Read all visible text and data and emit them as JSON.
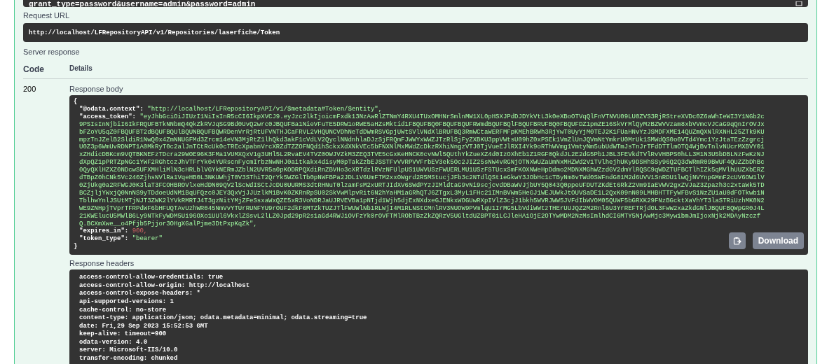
{
  "curl_tail": {
    "text": "grant_type=password&username=admin&password=admin"
  },
  "request_url": {
    "label": "Request URL",
    "value": "http://localhost/LFRepositoryAPI/v1/Repositories/laserfiche/Token"
  },
  "server_response": {
    "label": "Server response",
    "columns": [
      "Code",
      "Details"
    ],
    "code": "200",
    "body_label": "Response body",
    "body": {
      "open": "{",
      "close": "}",
      "entries": [
        {
          "key": "\"@odata.context\":",
          "value": "\"http://localhost/LFRepositoryAPI/v1/$metadata#Token/$entity\",",
          "kind": "string"
        },
        {
          "key": "\"access_token\":",
          "value": "\"eyJhbGciOiJIUzI1NiIsInR5cCI6IkpXVCJ9.eyJzc2lkIjoicmFxdk13NzAwRlZTNmY4RXU4TUxOMHNrSmlnMW1XL0pHSXJPdDJDYkVtL3k0eXBoOTVqQlFnVTNVU09LU0ZVS3RjRStreXVDc0Z6aWhIeWI3Y1NGb2c9PSIsInNjbiI6IkFRQUFBTkNNbmQ4QkZkRVJqSG9Bd0UvQ2wrc0JBQUFBa1NieVFuTE5DRW1oRWE5aHZsMktid1FBQUFBQ0FBQUFBQUFRWmdBQUFBQlFBQUFBRUFBQ0FBQUFDZ1pmZE16SkVrMlQyMzBZWVVzam8xbVVmcVJCaG9qQnIrOVJxbFZoYU5qZ0FBQUFBT2dBQUFBQUlBQUNBQUFBQWRDenVrRjRtUFVNTHJCaFRVL2VHQUNCVDhNeTdDWmRSVGpjUWtSVlVNdXlBRUFBQ3RmWCtaWERFMFpKMEhBRWh3RjYwT0UyYjM0TEJ2K1FUaHNvYzJSMDFXME14QUZmQXNlRXNHL25ZTk9KUmpzTnJZelB2SldiR1NwQ0x4ZmNNUGFMd3Zrcm14eVN3MjRtZ1lhQkd3akF1cVdLV2QyclNNdnhlaDJzSjFRQmFJWWYxWWZJTzRlSjFyZXBKU3ppVWtsU09hZ0xPSEk1VmZlUnJQVmNtYmkrU0MrUk1SMWdQS0o0VTd4Ymc1YzJtaTEzZzgrcjU0Z3p6WmUvRDNPT1A0MkRyT0c2alJnTCtRcUk0cTREcXpabnVrcXRZdTZZOFNQd1hSckxXdXNkVEc5bFNXNlMxMWdZcDkzRXhiNngzVTJ0TjVueEJlRXI4Yk9oRThWVmg1VmtyNm5ubUdWTmJsTnJrTFdDTTlmOTQ4WjBvTnlvNUcrMXBVY01xZHdicDBKcm9VQTBKNEFzTDcra29WOE96K3FMa1VUMXQxV1g3UHl5L2RvaEV4TVZ0OWJVZkM3ZEQ3TVE5cGxKeHNCK0cvNWl5QUthYkZueXZ4d0IzOXhEb1Z1RGF0QkdJL2E2dG5Pb1JBL3FEVkdTVlRvVHBPS0hLL3M1N3U5bDBLNzFwKzNJdXpQZ1pPRTZpNGc1YWF2RGhtczJhVTFrYk04YURscnFycmIrbzNwNHJ0aitkakx4disyM0pTakZzbEJSSTFvVVRPVVFrbEV3ek5Oc2JIZ25sNW4vRGNjOTNXWUZaUmNxMHZWd2V1TVlhejhUKy9DSHhSSy96Q2Q3dWRmR09BWUF4QUZZbDhBc0QyQXlHZXZ0NDcwSUFXMHliMlN3cHRLblVGYkNERmJZblN2UVR5a0pKODRPQXdiRnZBVHo3cXRTdzlRVzNFUlpUS1UWVUSzFWUERLMU1USzFSTUcxSmFKOXNWeHpDdmo2MDNXMGhWZzdGV2dmYlRQSC9qWDZTUFBCTlhIZk5qMVlhUUZXbERZdTBpZ0hCNk5Vc240ZjhsNVlRa1VqeHB0L3NKUWhjT0V3SThiT2QrYk5WZGlTb0pNWFBPa2JDL1V6UmFTM2xxOWgrd2R5MStucjJFb3c2NTdlQSt1eGkwY3JObHc1cTByNm8vTWd0SWFndG01M2d6UVV1SnRDU1lwQjNVYnpGMmF2cUV6OW1lV0ZjUkg0a2RFWGJ0K3laT3FCOHBROVlxeHdDN09QV2lScWdISCtJcDU0UURMS3dtRHNuT0lzamFsM2xURTJIdXV6SWdPYzJIMldtaG9vNi9scjcvdDBaWVJjbUY5Q043Q0ppeUFDUTZKdEt6RkZ2Vm9IaEVWV2gxZVJaZ3Zpazh3c2xtaWk5TDBCZjljYWxjQ0NnNS9yTDdoeUdNM1BqUFQzc0JEY3QxVjJJUzlkM1BvK0ZKRnRpSU02SkVwMlpvRit6N2hYaHM1aGRhQTJ6ZTgxL3MyL1FHc21IMnBVWm5HeGJ1WEJUWkJtOUVSaDE1L2QxK09nN09LMHBHTTFyWFBvS1NzZU1aU0dFOTkwb1NTblhwYnlJSUtMTjNJT3ZWK2lYVkRMRTJ4T3gzNitYMjZFeSsxaWxQZE5xR3VoNDRJaUJRVEVBa1pNTjd1Wjh5djExNXdxeGJENkxWOGUwRXpIVlZ3cjJ1bkh5WVRJWW5JVFdIbWVOM05QUWF5bGRXK29FNzBGcktXaVhYT3laSTRiUzhMK0N2WE9ZNHpjTVprTFRPdWF6bHFUQTAvUzhWR045NmVvYTUrRUNFYU9rOUF2dkF6MTZkTUZJTlFWUWlNb1RLWjI4M1RLNStCMnlRV3NUOW9PVmlqU1IrMG5LbVdiWWtzTHErUUJQZ2M2Rnl6U3YrREFTRjdOL3FwW2xaZkdGNlJBQUFBQWpGR0J4L21KWElucU5MWlB6Ly9NTkFyWDM5Ui96OXo1UUl6VkxlZSsvL2lLZ0Jpd29pR2s1aGd4RWJiOVFzYk0rOVFTMlRObTBzZkZQRzV5UGltdUZBPT0iLCJleHAiOjE2OTYwMDM2NzMsImlhdCI6MTY5NjAwMjc3MywibmJmIjoxNjk2MDAyNzczfQ.BCXmXwe__o4Pfjb5Pjjor3OHgXGalPjme3DtPxpKqZk\",",
          "kind": "string"
        },
        {
          "key": "\"expires_in\":",
          "value": "900,",
          "kind": "number"
        },
        {
          "key": "\"token_type\":",
          "value": "\"bearer\"",
          "kind": "string"
        }
      ]
    },
    "download": "Download",
    "headers_label": "Response headers",
    "headers": [
      "access-control-allow-credentials: true",
      "access-control-allow-origin: http://localhost",
      "access-control-expose-headers: *",
      "api-supported-versions: 1",
      "cache-control: no-store",
      "content-type: application/json; odata.metadata=minimal; odata.streaming=true",
      "date: Fri,29 Sep 2023 15:52:53 GMT",
      "keep-alive: timeout=900",
      "odata-version: 4.0",
      "server: Microsoft-IIS/10.0",
      "transfer-encoding: chunked"
    ]
  }
}
